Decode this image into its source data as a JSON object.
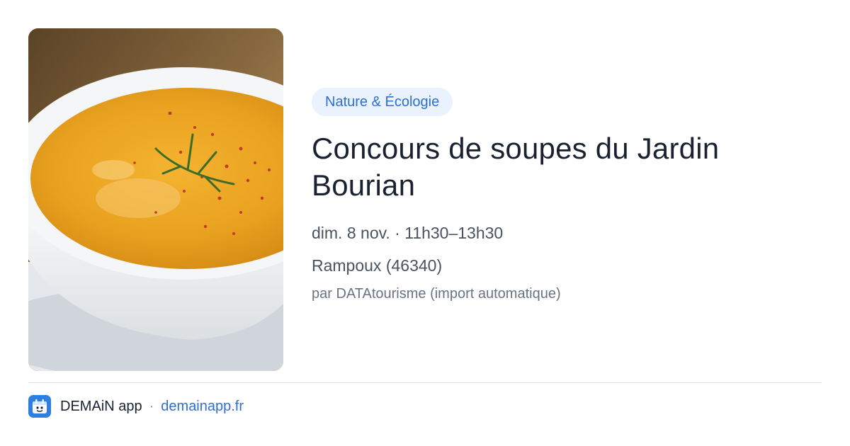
{
  "event": {
    "image": "soup-bowl-photo",
    "category": "Nature & Écologie",
    "title": "Concours de soupes du Jardin Bourian",
    "datetime": "dim. 8 nov. · 11h30–13h30",
    "location": "Rampoux (46340)",
    "source": "par DATAtourisme (import automatique)"
  },
  "footer": {
    "app_name": "DEMAiN app",
    "separator": "·",
    "link_text": "demainapp.fr",
    "logo_icon": "app-logo-icon"
  },
  "colors": {
    "accent": "#2f6fd1",
    "pill_background": "#eaf2fd",
    "title": "#1a2232",
    "muted": "#4a5261"
  }
}
